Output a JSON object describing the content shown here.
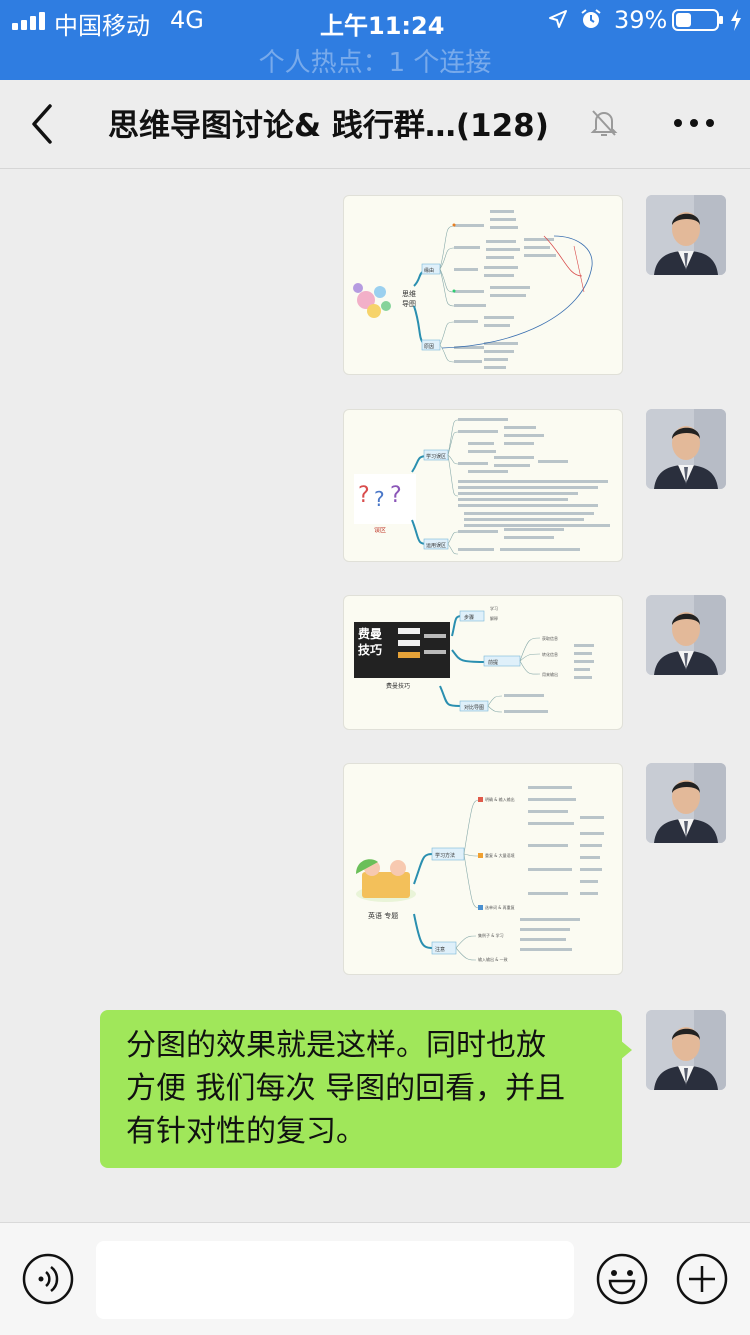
{
  "status": {
    "carrier": "中国移动",
    "network": "4G",
    "time": "上午11:24",
    "battery": "39%",
    "battery_level": 0.39
  },
  "hotspot": "个人热点：1 个连接",
  "nav": {
    "title": "思维导图讨论& 践行群…(128)",
    "back_icon": "chevron-left-icon",
    "mute_icon": "bell-muted-icon",
    "more_icon": "more-dots-icon"
  },
  "messages": [
    {
      "type": "image",
      "from": "self",
      "center_label_lines": [
        "思维",
        "导图"
      ],
      "branches": [
        "缘由",
        "原因"
      ]
    },
    {
      "type": "image",
      "from": "self",
      "center_label_lines": [
        "误区"
      ],
      "branches": [
        "学习误区",
        "运用误区"
      ]
    },
    {
      "type": "image",
      "from": "self",
      "cover_lines": [
        "费曼",
        "技巧"
      ],
      "center_label_lines": [
        "费曼技巧"
      ],
      "branches": [
        "步骤",
        "前提",
        "对比导图"
      ],
      "leaves": [
        "学习",
        "解释",
        "获取信息",
        "转化信息",
        "用来输出"
      ]
    },
    {
      "type": "image",
      "from": "self",
      "center_label_lines": [
        "英语 专题"
      ],
      "branches": [
        "学习方法",
        "注意"
      ],
      "leaves": [
        "明确 & 输入输出",
        "重复 & 大量语境",
        "选单词 & 再重复",
        "集例子 & 学习",
        "输入输出 & 一致"
      ]
    },
    {
      "type": "text",
      "from": "self",
      "lines": [
        "分图的效果就是这样。同时也放",
        "方便 我们每次 导图的回看，并且",
        "有针对性的复习。"
      ]
    }
  ],
  "input": {
    "value": "",
    "voice_icon": "voice-icon",
    "emoji_icon": "emoji-icon",
    "plus_icon": "plus-icon"
  }
}
